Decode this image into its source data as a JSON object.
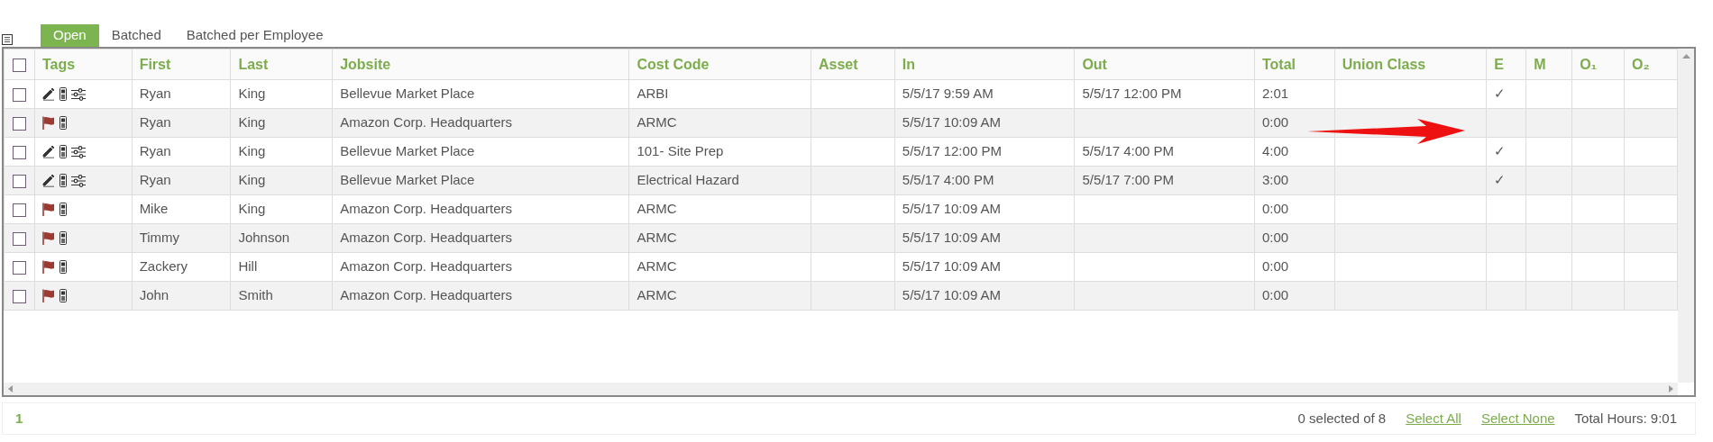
{
  "tabs": [
    {
      "label": "Open",
      "selected": true
    },
    {
      "label": "Batched",
      "selected": false
    },
    {
      "label": "Batched per Employee",
      "selected": false
    }
  ],
  "table": {
    "select_all_checked": false,
    "columns": [
      "Tags",
      "First",
      "Last",
      "Jobsite",
      "Cost Code",
      "Asset",
      "In",
      "Out",
      "Total",
      "Union Class",
      "E",
      "M",
      "O₁",
      "O₂"
    ],
    "rows": [
      {
        "checked": false,
        "tags": [
          {
            "kind": "edit"
          },
          {
            "kind": "phone"
          },
          {
            "kind": "sliders"
          }
        ],
        "first": "Ryan",
        "last": "King",
        "jobsite": "Bellevue Market Place",
        "cost_code": "ARBI",
        "in": "5/5/17 9:59 AM",
        "out": "5/5/17 12:00 PM",
        "total": "2:01",
        "e": "✓"
      },
      {
        "checked": false,
        "tags": [
          {
            "kind": "flag"
          },
          {
            "kind": "phone"
          }
        ],
        "first": "Ryan",
        "last": "King",
        "jobsite": "Amazon Corp. Headquarters",
        "cost_code": "ARMC",
        "in": "5/5/17 10:09 AM",
        "total": "0:00"
      },
      {
        "checked": false,
        "tags": [
          {
            "kind": "edit"
          },
          {
            "kind": "phone"
          },
          {
            "kind": "sliders"
          }
        ],
        "first": "Ryan",
        "last": "King",
        "jobsite": "Bellevue Market Place",
        "cost_code": "101- Site Prep",
        "in": "5/5/17 12:00 PM",
        "out": "5/5/17 4:00 PM",
        "total": "4:00",
        "e": "✓"
      },
      {
        "checked": false,
        "tags": [
          {
            "kind": "edit"
          },
          {
            "kind": "phone"
          },
          {
            "kind": "sliders"
          }
        ],
        "first": "Ryan",
        "last": "King",
        "jobsite": "Bellevue Market Place",
        "cost_code": "Electrical Hazard",
        "in": "5/5/17 4:00 PM",
        "out": "5/5/17 7:00 PM",
        "total": "3:00",
        "e": "✓"
      },
      {
        "checked": false,
        "tags": [
          {
            "kind": "flag"
          },
          {
            "kind": "phone"
          }
        ],
        "first": "Mike",
        "last": "King",
        "jobsite": "Amazon Corp. Headquarters",
        "cost_code": "ARMC",
        "in": "5/5/17 10:09 AM",
        "total": "0:00"
      },
      {
        "checked": false,
        "tags": [
          {
            "kind": "flag"
          },
          {
            "kind": "phone"
          }
        ],
        "first": "Timmy",
        "last": "Johnson",
        "jobsite": "Amazon Corp. Headquarters",
        "cost_code": "ARMC",
        "in": "5/5/17 10:09 AM",
        "total": "0:00"
      },
      {
        "checked": false,
        "tags": [
          {
            "kind": "flag"
          },
          {
            "kind": "phone"
          }
        ],
        "first": "Zackery",
        "last": "Hill",
        "jobsite": "Amazon Corp. Headquarters",
        "cost_code": "ARMC",
        "in": "5/5/17 10:09 AM",
        "total": "0:00"
      },
      {
        "checked": false,
        "tags": [
          {
            "kind": "flag"
          },
          {
            "kind": "phone"
          }
        ],
        "first": "John",
        "last": "Smith",
        "jobsite": "Amazon Corp. Headquarters",
        "cost_code": "ARMC",
        "in": "5/5/17 10:09 AM",
        "total": "0:00"
      }
    ]
  },
  "footer": {
    "page": "1",
    "selection": "0 selected of 8",
    "links": [
      "Select All",
      "Select None"
    ],
    "total_hours": "Total Hours: 9:01"
  }
}
